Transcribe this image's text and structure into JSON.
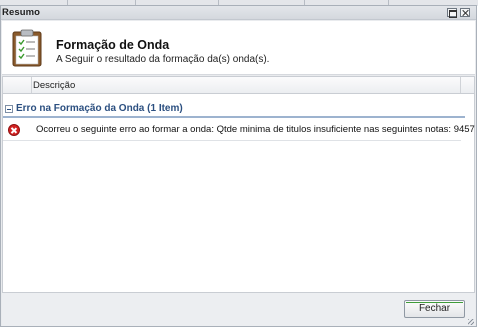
{
  "window": {
    "title": "Resumo"
  },
  "header": {
    "title": "Formação de Onda",
    "subtitle": "A Seguir o resultado da formação da(s) onda(s)."
  },
  "grid": {
    "columns": [
      "",
      "Descrição"
    ],
    "group": {
      "label": "Erro na Formação da Onda (1 Item)"
    },
    "rows": [
      {
        "status_icon": "error-icon",
        "description": "Ocorreu o seguinte erro ao formar a onda: Qtde minima de titulos insuficiente nas seguintes notas: 9457"
      }
    ]
  },
  "footer": {
    "close_label": "Fechar"
  },
  "colors": {
    "group_text": "#2b4f80",
    "error_icon": "#d32222",
    "button_focus": "#3f9c3a"
  }
}
